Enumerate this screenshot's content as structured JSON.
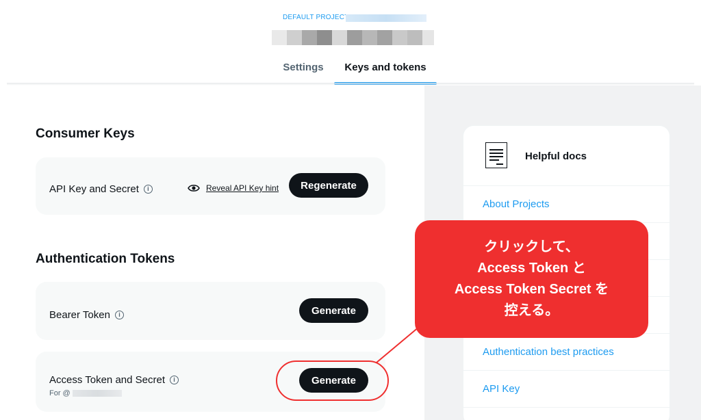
{
  "header": {
    "project_label": "DEFAULT PROJECT-",
    "tabs": [
      {
        "label": "Settings",
        "active": false
      },
      {
        "label": "Keys and tokens",
        "active": true
      }
    ]
  },
  "consumer_keys": {
    "heading": "Consumer Keys",
    "api_key_row": {
      "label": "API Key and Secret",
      "reveal_link": "Reveal API Key hint",
      "button": "Regenerate"
    }
  },
  "auth_tokens": {
    "heading": "Authentication Tokens",
    "bearer_row": {
      "label": "Bearer Token",
      "button": "Generate"
    },
    "access_row": {
      "label": "Access Token and Secret",
      "for_prefix": "For @",
      "button": "Generate"
    }
  },
  "helpful_docs": {
    "title": "Helpful docs",
    "links": [
      "About Projects",
      "Authentication best practices",
      "API Key"
    ]
  },
  "annotation": {
    "lines": [
      "クリックして、",
      "Access Token と",
      "Access Token Secret を",
      "控える。"
    ]
  },
  "colors": {
    "accent": "#1d9bf0",
    "annotation_red": "#ef2f2f",
    "button_dark": "#0f1419"
  }
}
